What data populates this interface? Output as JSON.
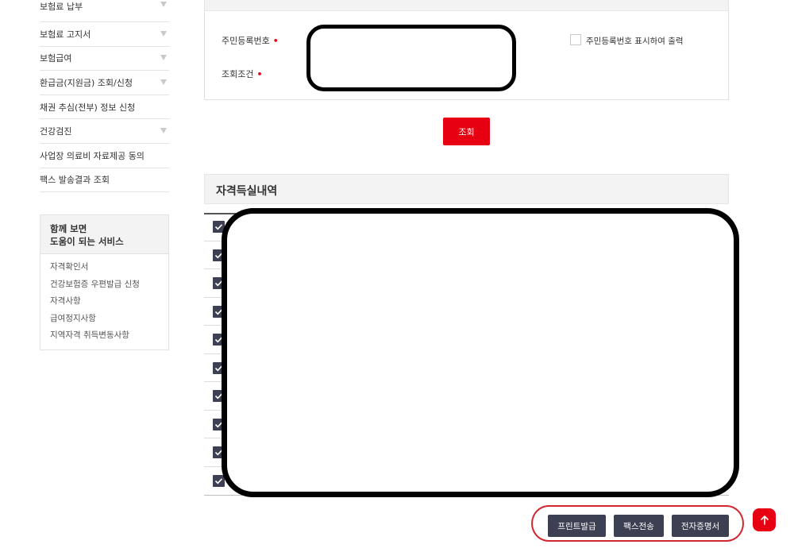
{
  "sidebar": {
    "menu": [
      {
        "label": "보험료 납부",
        "has_submenu": true
      },
      {
        "label": "보험료 고지서",
        "has_submenu": true
      },
      {
        "label": "보험급여",
        "has_submenu": true
      },
      {
        "label": "환급금(지원금) 조회/신청",
        "has_submenu": true
      },
      {
        "label": "채권 추심(전부) 정보 신청",
        "has_submenu": false
      },
      {
        "label": "건강검진",
        "has_submenu": true
      },
      {
        "label": "사업장 의료비 자료제공 동의",
        "has_submenu": false
      },
      {
        "label": "팩스 발송결과 조회",
        "has_submenu": false
      }
    ],
    "related": {
      "title_line1": "함께 보면",
      "title_line2": "도움이 되는 서비스",
      "links": [
        "자격확인서",
        "건강보험증 우편발급 신청",
        "자격사항",
        "급여정지사항",
        "지역자격 취득변동사항"
      ]
    }
  },
  "search": {
    "rrn_label": "주민등록번호",
    "condition_label": "조회조건",
    "required_mark": "•",
    "show_rrn_label": "주민등록번호 표시하여 출력",
    "submit_label": "조회"
  },
  "results": {
    "title": "자격득실내역",
    "row_count": 10
  },
  "actions": {
    "print_label": "프린트발급",
    "fax_label": "팩스전송",
    "ecert_label": "전자증명서",
    "to_top_icon": "arrow-up-icon"
  },
  "colors": {
    "accent_red": "#e60012",
    "dark_button": "#3d3f52",
    "annotation_red": "#d2272f"
  }
}
